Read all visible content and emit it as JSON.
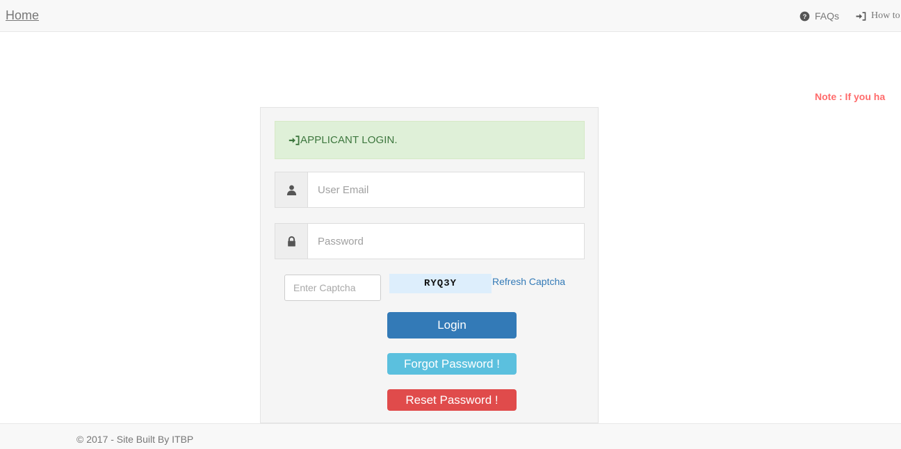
{
  "navbar": {
    "brand": "Home",
    "links": [
      {
        "label": "FAQs",
        "icon": "question-circle-icon"
      },
      {
        "label": "How  to  l",
        "icon": "sign-in-icon"
      }
    ]
  },
  "note": {
    "text": "Note : If you ha"
  },
  "panel": {
    "alert": {
      "text": "APPLICANT LOGIN.",
      "icon": "sign-in-icon",
      "bg_color": "#dff0d8",
      "text_color": "#3c763d"
    },
    "fields": {
      "email": {
        "placeholder": "User Email",
        "value": "",
        "icon": "user-icon"
      },
      "password": {
        "placeholder": "Password",
        "value": "",
        "icon": "lock-icon"
      },
      "captcha": {
        "placeholder": "Enter Captcha",
        "value": ""
      }
    },
    "captcha": {
      "code": "RYQ3Y",
      "refresh_label": "Refresh Captcha",
      "image_bg": "#ddeefc",
      "link_color": "#337ab7"
    },
    "buttons": {
      "login": {
        "label": "Login",
        "color": "#337ab7"
      },
      "forgot": {
        "label": "Forgot Password !",
        "color": "#5bc0de"
      },
      "reset": {
        "label": "Reset Password !",
        "color": "#e04b4b"
      }
    }
  },
  "footer": {
    "text": "© 2017 - Site Built By ITBP"
  }
}
